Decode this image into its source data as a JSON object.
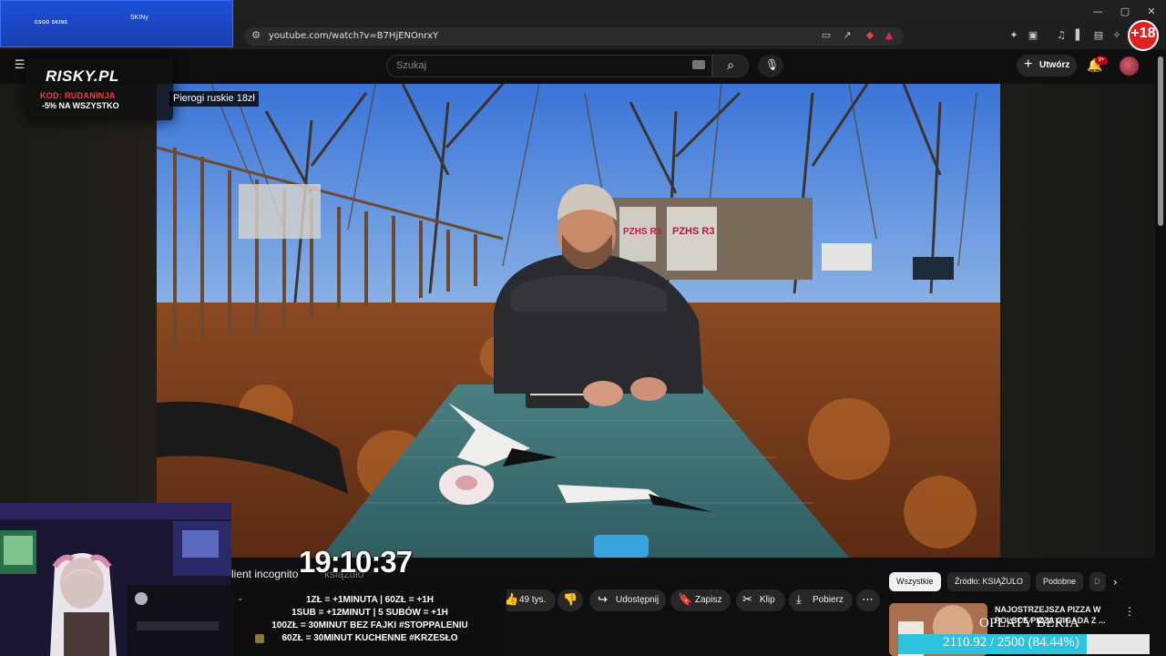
{
  "browser": {
    "url": "youtube.com/watch?v=B7HjENOnrxY",
    "window_controls": [
      "—",
      "▢",
      "✕"
    ]
  },
  "sponsor": {
    "logo_text": "CSGO SKINS",
    "right_text": "SKINy"
  },
  "age_badge": "+18",
  "youtube": {
    "search_placeholder": "Szukaj",
    "create_label": "Utwórz",
    "notifications_badge": "9+"
  },
  "overlay_ad": {
    "logo": "RISKY.PL",
    "code": "KOD: RUDANINJA",
    "discount": "-5% NA WSZYSTKO"
  },
  "video": {
    "caption": "Pierogi ruskie 18zł",
    "graffiti": [
      "PZHS R3",
      "PZHS R3"
    ]
  },
  "stream_clock": "19:10:37",
  "channel_line": {
    "visible": "lient incognito",
    "faded": "ksiązulo"
  },
  "actions": {
    "likes": "49 tys.",
    "share": "Udostępnij",
    "save": "Zapisz",
    "clip": "Klip",
    "download": "Pobierz"
  },
  "donation_rules": [
    "1ZŁ = +1MINUTA | 60ZŁ = +1H",
    "1SUB = +12MINUT | 5 SUBÓW = +1H",
    "100ZŁ = 30MINUT BEZ FAJKI #STOPPALENIU",
    "60ZŁ = 30MINUT KUCHENNE #KRZESŁO"
  ],
  "sidebar": {
    "chips": [
      "Wszystkie",
      "Źródło: KSIĄŻULO",
      "Podobne",
      "D"
    ],
    "recommendation_title": "NAJOSTRZEJSZA PIZZA W POLSCE PIZZA GIGADA Z ...",
    "overlay_text": "OPŁATY BEKIA"
  },
  "goal": {
    "text": "2110.92 / 2500 (84.44%)",
    "current": 2110.92,
    "target": 2500,
    "percent": 84.44
  },
  "colors": {
    "accent_red": "#cc0000",
    "goal_fill": "#2fc2dd",
    "sponsor_blue": "#1c4fd6"
  }
}
